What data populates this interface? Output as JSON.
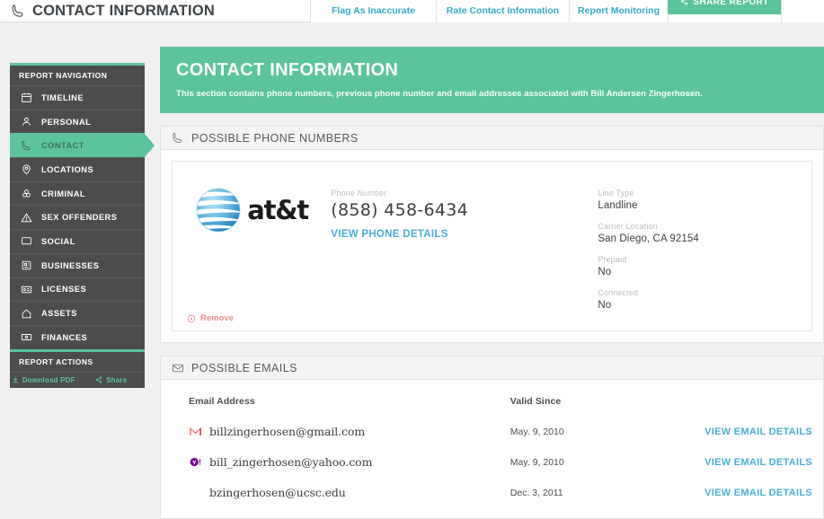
{
  "topbar": {
    "icon": "phone-icon",
    "title": "CONTACT INFORMATION",
    "tabs": [
      {
        "label": "Flag As Inaccurate",
        "name": "tab-flag-as-inaccurate"
      },
      {
        "label": "Rate Contact Information",
        "name": "tab-rate-contact-information"
      },
      {
        "label": "Report Monitoring",
        "name": "tab-report-monitoring"
      }
    ],
    "share_button": {
      "label": "SHARE REPORT",
      "icon": "share-icon",
      "color": "#5bc49d"
    }
  },
  "sidebar": {
    "nav_header": "REPORT NAVIGATION",
    "items": [
      {
        "label": "TIMELINE",
        "icon": "calendar-icon",
        "active": false
      },
      {
        "label": "PERSONAL",
        "icon": "person-icon",
        "active": false
      },
      {
        "label": "CONTACT",
        "icon": "phone-icon",
        "active": true
      },
      {
        "label": "LOCATIONS",
        "icon": "map-pin-icon",
        "active": false
      },
      {
        "label": "CRIMINAL",
        "icon": "fingerprint-icon",
        "active": false
      },
      {
        "label": "SEX OFFENDERS",
        "icon": "warning-icon",
        "active": false
      },
      {
        "label": "SOCIAL",
        "icon": "monitor-icon",
        "active": false
      },
      {
        "label": "BUSINESSES",
        "icon": "building-icon",
        "active": false
      },
      {
        "label": "LICENSES",
        "icon": "id-card-icon",
        "active": false
      },
      {
        "label": "ASSETS",
        "icon": "home-icon",
        "active": false
      },
      {
        "label": "FINANCES",
        "icon": "money-icon",
        "active": false
      }
    ],
    "actions_header": "REPORT ACTIONS",
    "actions": [
      {
        "label": "Download PDF",
        "icon": "download-icon"
      },
      {
        "label": "Share",
        "icon": "share-icon"
      }
    ],
    "accent_color": "#5bc49d",
    "background_color": "#4c4c4c"
  },
  "hero": {
    "title": "CONTACT INFORMATION",
    "description": "This section contains phone numbers, previous phone number and email addresses associated with Bill Andersen Zingerhosen.",
    "background_color": "#5bc49d"
  },
  "phones_panel": {
    "icon": "phone-icon",
    "header": "POSSIBLE PHONE NUMBERS",
    "card": {
      "carrier_logo": "att-logo",
      "carrier_name": "at&t",
      "phone_label": "Phone Number",
      "phone_value": "(858) 458-6434",
      "details_link": "VIEW PHONE DETAILS",
      "fields": [
        {
          "label": "Line Type",
          "value": "Landline",
          "wide": false
        },
        {
          "label": "Carrier Location",
          "value": "San Diego, CA 92154",
          "wide": true
        },
        {
          "label": "Prepaid",
          "value": "No",
          "wide": false
        },
        {
          "label": "Connected",
          "value": "No",
          "wide": true
        }
      ],
      "remove_label": "Remove",
      "remove_icon": "remove-circle-icon"
    }
  },
  "emails_panel": {
    "icon": "envelope-icon",
    "header": "POSSIBLE EMAILS",
    "columns": {
      "address": "Email Address",
      "valid_since": "Valid Since"
    },
    "rows": [
      {
        "icon": "gmail-icon",
        "address": "billzingerhosen@gmail.com",
        "valid_since": "May. 9, 2010",
        "link": "VIEW EMAIL DETAILS"
      },
      {
        "icon": "yahoo-icon",
        "address": "bill_zingerhosen@yahoo.com",
        "valid_since": "May. 9, 2010",
        "link": "VIEW EMAIL DETAILS"
      },
      {
        "icon": "none",
        "address": "bzingerhosen@ucsc.edu",
        "valid_since": "Dec. 3, 2011",
        "link": "VIEW EMAIL DETAILS"
      }
    ]
  }
}
